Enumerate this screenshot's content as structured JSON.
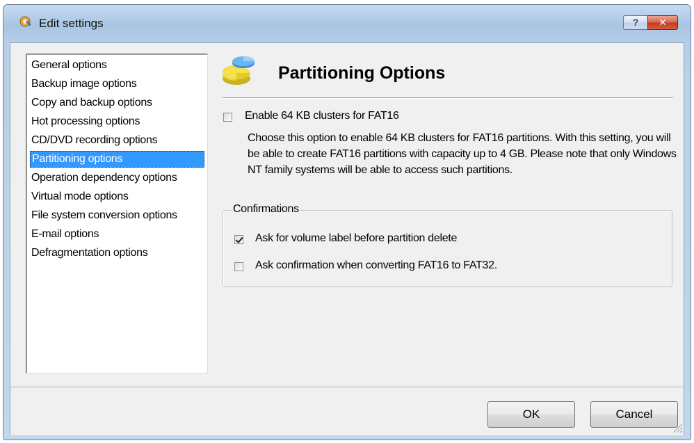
{
  "window": {
    "title": "Edit settings",
    "help_label": "?",
    "close_label": "✕"
  },
  "nav": {
    "items": [
      {
        "label": "General options"
      },
      {
        "label": "Backup image options"
      },
      {
        "label": "Copy and backup options"
      },
      {
        "label": "Hot processing options"
      },
      {
        "label": "CD/DVD recording options"
      },
      {
        "label": "Partitioning options",
        "selected": true
      },
      {
        "label": "Operation dependency options"
      },
      {
        "label": "Virtual mode options"
      },
      {
        "label": "File system conversion options"
      },
      {
        "label": "E-mail options"
      },
      {
        "label": "Defragmentation options"
      }
    ]
  },
  "page": {
    "title": "Partitioning Options",
    "icon": "partition-pie-icon"
  },
  "options": {
    "fat16_clusters": {
      "label": "Enable 64 KB clusters for FAT16",
      "checked": false,
      "description": "Choose this option to enable 64 KB clusters for FAT16 partitions. With this setting, you will be able to create FAT16 partitions with capacity up to 4 GB. Please note that only Windows NT family systems will be able to access such partitions."
    }
  },
  "confirmations": {
    "group_label": "Confirmations",
    "items": [
      {
        "label": "Ask for volume label before partition delete",
        "checked": true
      },
      {
        "label": "Ask confirmation when converting FAT16 to FAT32.",
        "checked": false
      }
    ]
  },
  "buttons": {
    "ok": "OK",
    "cancel": "Cancel"
  },
  "colors": {
    "selection": "#3399ff",
    "dialog_bg": "#f0f0f0",
    "close_button": "#c43b22"
  }
}
